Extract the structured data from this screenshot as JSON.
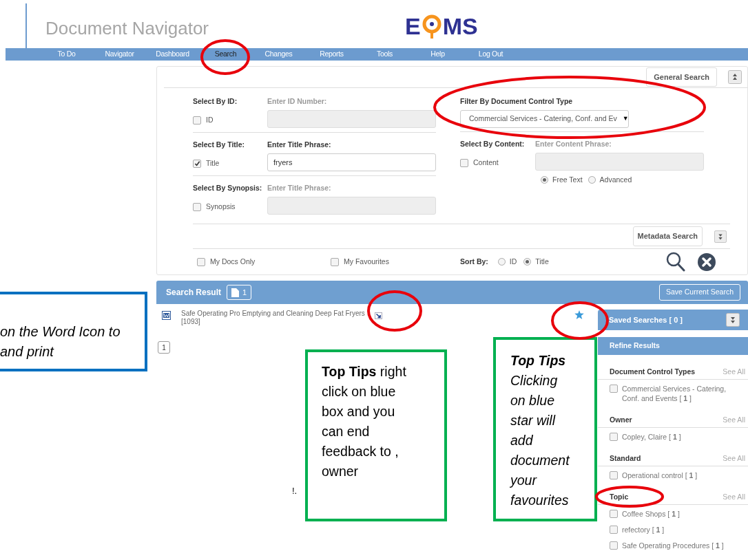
{
  "header": {
    "title": "Document Navigator",
    "logo": [
      "E",
      "MS"
    ]
  },
  "nav": [
    {
      "label": "To Do",
      "selected": false
    },
    {
      "label": "Navigator",
      "selected": false
    },
    {
      "label": "Dashboard",
      "selected": false
    },
    {
      "label": "Search",
      "selected": true
    },
    {
      "label": "Changes",
      "selected": false
    },
    {
      "label": "Reports",
      "selected": false
    },
    {
      "label": "Tools",
      "selected": false
    },
    {
      "label": "Help",
      "selected": false
    },
    {
      "label": "Log Out",
      "selected": false
    }
  ],
  "search_form": {
    "general_search_button": "General Search",
    "rows": [
      {
        "section": "Select By ID:",
        "checkbox": {
          "label": "ID",
          "checked": false
        },
        "field": {
          "label": "Enter ID Number:",
          "disabled": true
        }
      },
      {
        "section": "Select By Title:",
        "checkbox": {
          "label": "Title",
          "checked": true
        },
        "field": {
          "label": "Enter Title Phrase:",
          "value": "fryers",
          "disabled": false
        }
      },
      {
        "section": "Select By Synopsis:",
        "checkbox": {
          "label": "Synopsis",
          "checked": false
        },
        "field": {
          "label": "Enter Title Phrase:",
          "disabled": true
        }
      }
    ],
    "filter": {
      "label": "Filter By Document Control Type",
      "value": "Commercial Services - Catering, Conf. and Ev",
      "caret": "▼"
    },
    "content": {
      "section": "Select By Content:",
      "checkbox": {
        "label": "Content",
        "checked": false
      },
      "field": {
        "label": "Enter Content Phrase:",
        "disabled": true
      },
      "modes": [
        {
          "label": "Free Text",
          "selected": true
        },
        {
          "label": "Advanced",
          "selected": false
        }
      ]
    },
    "metadata_search_button": "Metadata Search",
    "options": [
      {
        "label": "My Docs Only",
        "checked": false
      },
      {
        "label": "My Favourites",
        "checked": false
      }
    ],
    "sort": {
      "label": "Sort By:",
      "options": [
        {
          "label": "ID",
          "selected": false
        },
        {
          "label": "Title",
          "selected": true
        }
      ]
    }
  },
  "results": {
    "title": "Search Result",
    "count": "1",
    "save_button": "Save Current Search",
    "items": [
      {
        "title": "Safe Operating Pro Emptying and Cleaning Deep Fat Fryers",
        "id": "[1093]"
      }
    ],
    "pages": [
      {
        "label": "1"
      }
    ]
  },
  "sidebar": {
    "saved_searches": "Saved Searches [ 0 ]",
    "refine_title": "Refine Results",
    "groups": [
      {
        "title": "Document Control Types",
        "see_all": "See All",
        "items": [
          {
            "label": "Commercial Services - Catering, Conf. and Events [ **1** ]",
            "checked": false
          }
        ]
      },
      {
        "title": "Owner",
        "see_all": "See All",
        "items": [
          {
            "label": "Copley, Claire [ **1** ]",
            "checked": false
          }
        ]
      },
      {
        "title": "Standard",
        "see_all": "See All",
        "items": [
          {
            "label": "Operational control [ **1** ]",
            "checked": false
          }
        ]
      },
      {
        "title": "Topic",
        "see_all": "See All",
        "items": [
          {
            "label": "Coffee Shops [ **1** ]",
            "checked": false
          },
          {
            "label": "refectory [ **1** ]",
            "checked": false
          },
          {
            "label": "Safe Operating Procedures [ **1** ]",
            "checked": false
          }
        ]
      }
    ]
  },
  "annotations": {
    "callouts": [
      {
        "kind": "note",
        "color": "#0070c0",
        "text": "on the Word Icon to and print"
      },
      {
        "kind": "tip",
        "color": "#00b050",
        "text": "**Top Tips** right click on blue box and you can end feedback to , owner"
      },
      {
        "kind": "tip_italic",
        "color": "#00b050",
        "text": "**Top Tips** Clicking on blue star will add document your favourites"
      }
    ],
    "stray_text": "!."
  }
}
